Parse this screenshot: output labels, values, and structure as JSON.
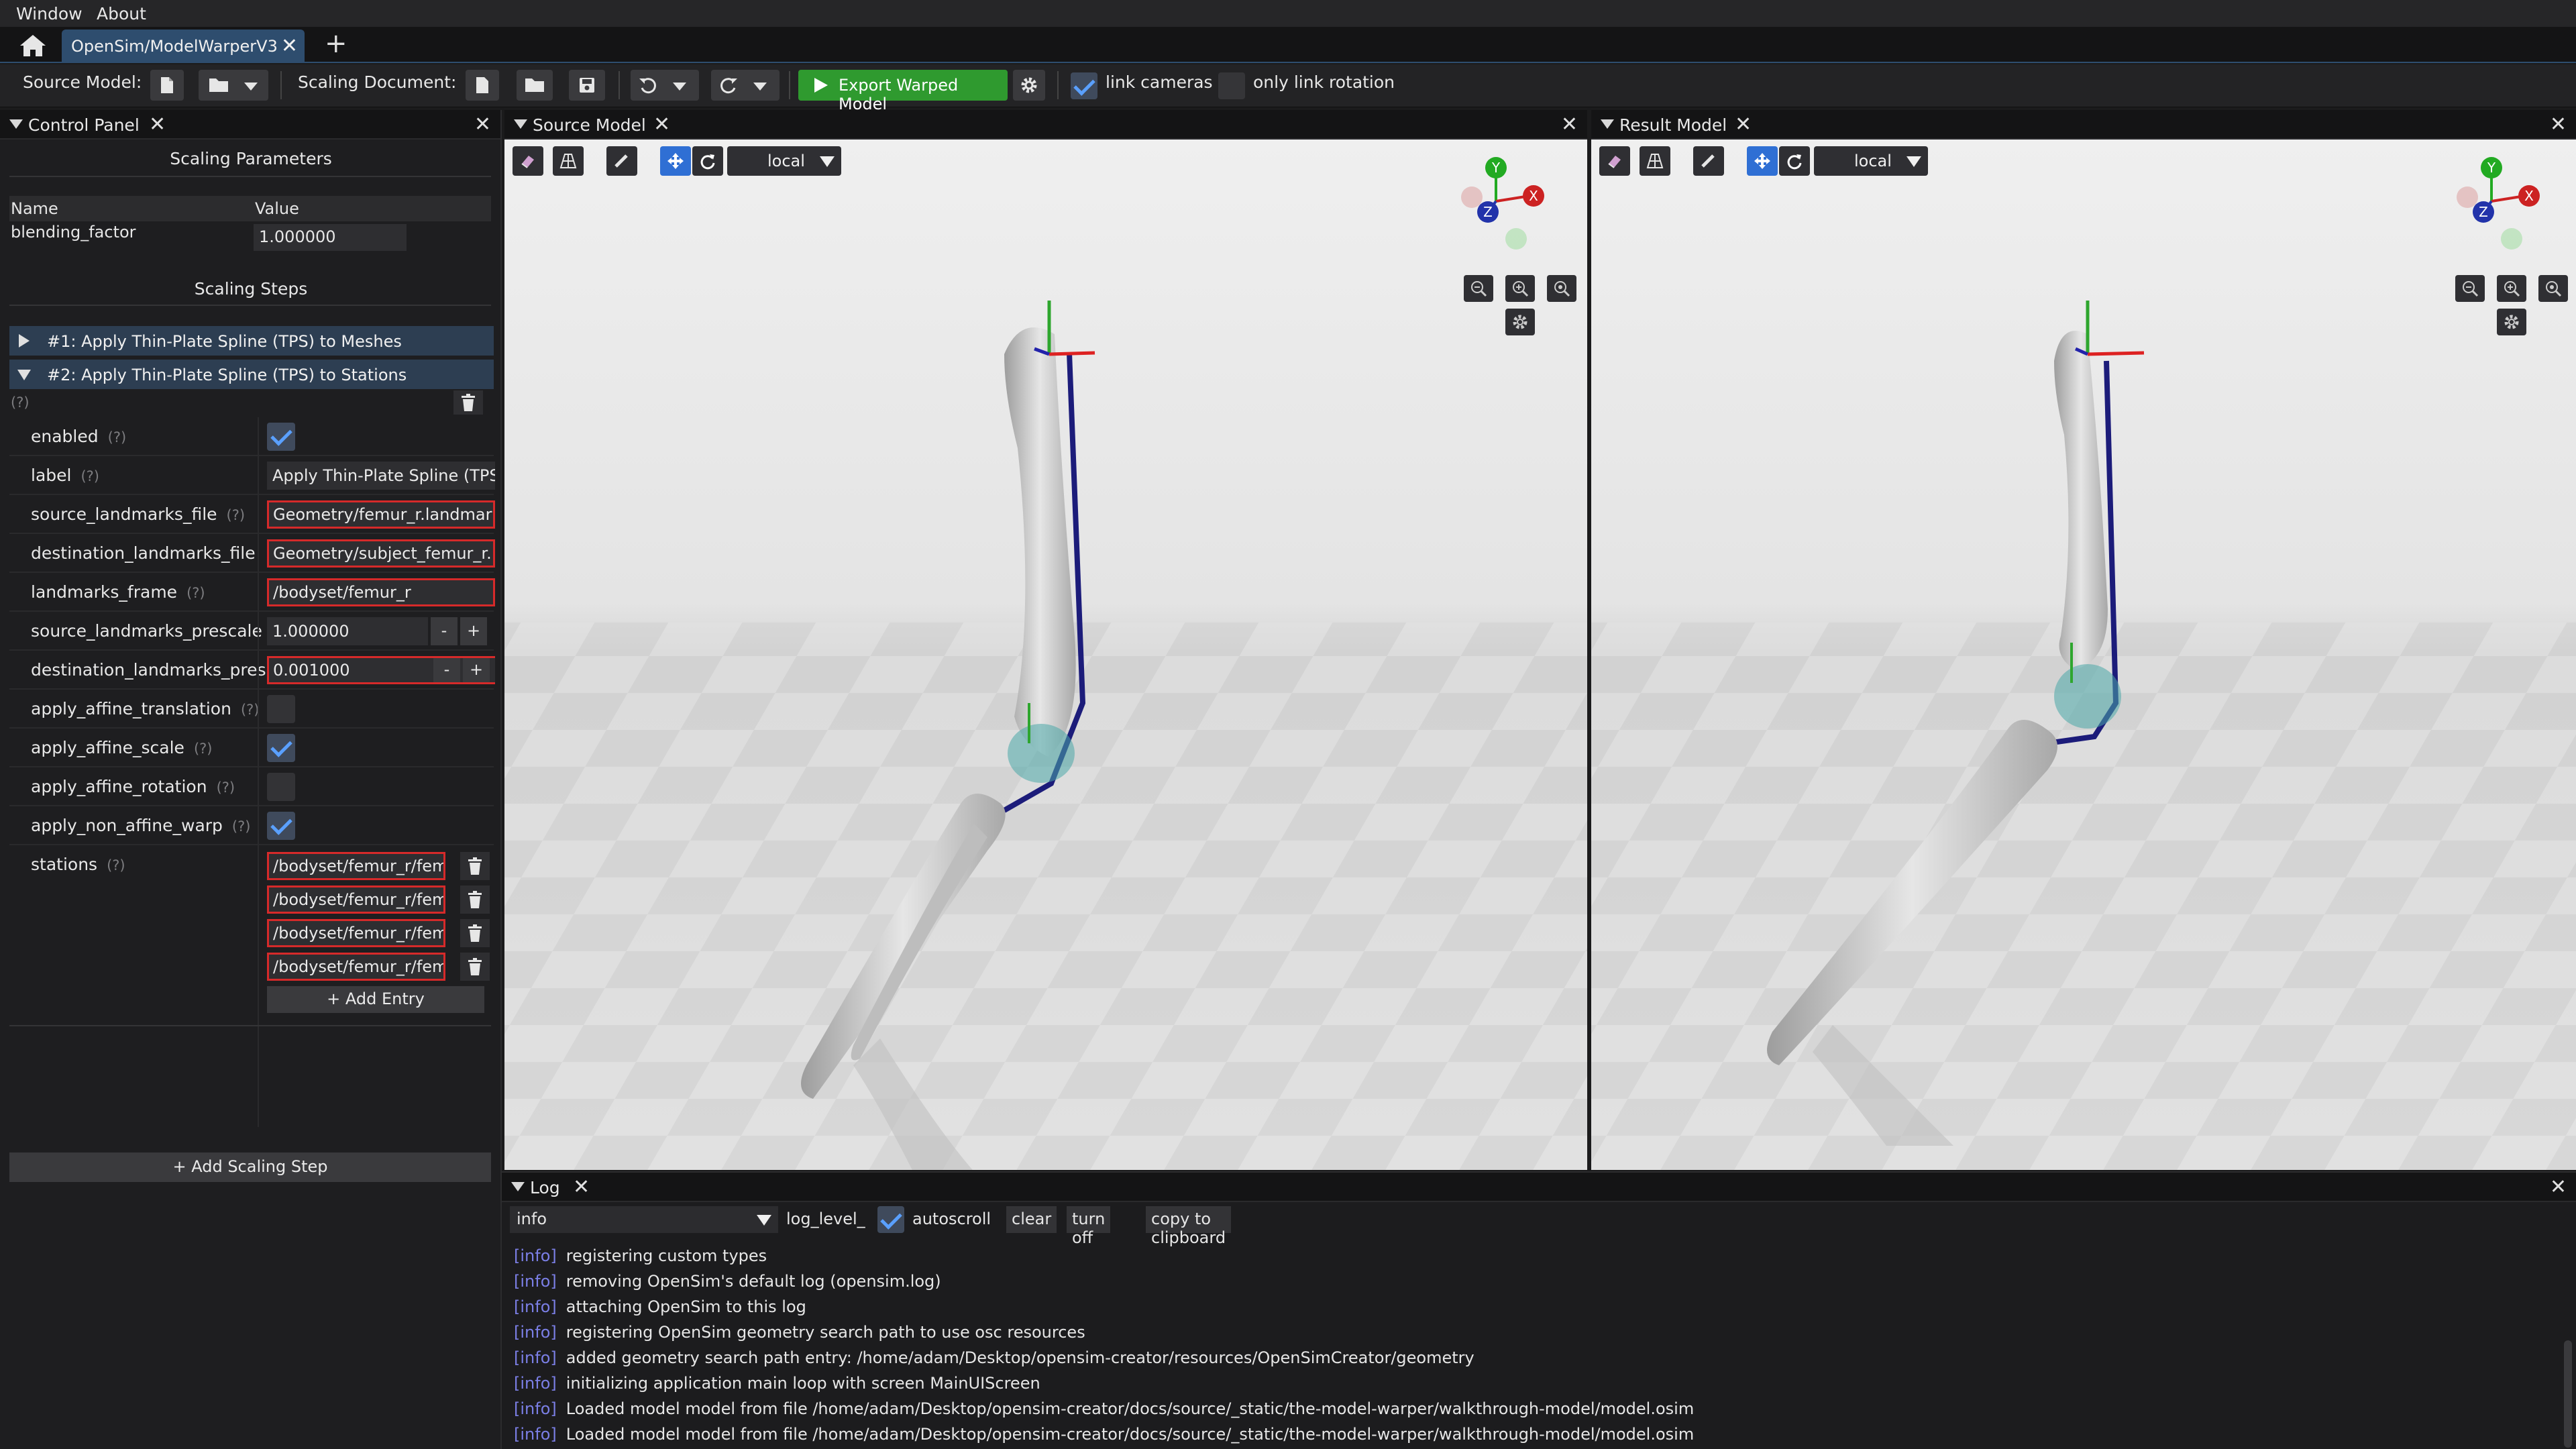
{
  "menu": {
    "window": "Window",
    "about": "About"
  },
  "tabs": {
    "active_tab": "OpenSim/ModelWarperV3",
    "close": "✕",
    "add": "+"
  },
  "toolbar": {
    "source_model_label": "Source Model:",
    "scaling_document_label": "Scaling Document:",
    "export_label": "Export Warped Model",
    "link_cameras_label": "link cameras",
    "link_cameras_checked": true,
    "only_link_rotation_label": "only link rotation",
    "only_link_rotation_checked": false
  },
  "control_panel": {
    "title": "Control Panel",
    "scaling_parameters_title": "Scaling Parameters",
    "param_table": {
      "col_name": "Name",
      "col_value": "Value",
      "rows": [
        {
          "name": "blending_factor",
          "value": "1.000000"
        }
      ]
    },
    "scaling_steps_title": "Scaling Steps",
    "steps": [
      {
        "label": "#1: Apply Thin-Plate Spline (TPS) to Meshes",
        "expanded": false
      },
      {
        "label": "#2: Apply Thin-Plate Spline (TPS) to Stations",
        "expanded": true
      }
    ],
    "help_marker": "(?)",
    "properties": [
      {
        "name": "enabled",
        "help": "(?)",
        "type": "checkbox",
        "checked": true
      },
      {
        "name": "label",
        "help": "(?)",
        "type": "text",
        "value": "Apply Thin-Plate Spline (TPS) to Stations",
        "error": false
      },
      {
        "name": "source_landmarks_file",
        "help": "(?)",
        "type": "text",
        "value": "Geometry/femur_r.landmarks",
        "error": true
      },
      {
        "name": "destination_landmarks_file",
        "help": "",
        "type": "text",
        "value": "Geometry/subject_femur_r.landmarks",
        "error": true
      },
      {
        "name": "landmarks_frame",
        "help": "(?)",
        "type": "text",
        "value": "/bodyset/femur_r",
        "error": true
      },
      {
        "name": "source_landmarks_prescale",
        "help": "",
        "type": "number",
        "value": "1.000000",
        "error": false
      },
      {
        "name": "destination_landmarks_pres",
        "help": "",
        "type": "number",
        "value": "0.001000",
        "error": true
      },
      {
        "name": "apply_affine_translation",
        "help": "(?)",
        "type": "checkbox",
        "checked": false
      },
      {
        "name": "apply_affine_scale",
        "help": "(?)",
        "type": "checkbox",
        "checked": true
      },
      {
        "name": "apply_affine_rotation",
        "help": "(?)",
        "type": "checkbox",
        "checked": false
      },
      {
        "name": "apply_non_affine_warp",
        "help": "(?)",
        "type": "checkbox",
        "checked": true
      }
    ],
    "stations": {
      "name": "stations",
      "help": "(?)",
      "entries": [
        "/bodyset/femur_r/femur_r_station",
        "/bodyset/femur_r/femur_r_station",
        "/bodyset/femur_r/femur_r_station",
        "/bodyset/femur_r/femur_r_station"
      ],
      "add_entry_label": "Add Entry"
    },
    "add_step_label": "Add Scaling Step"
  },
  "source_panel": {
    "title": "Source Model",
    "frame_option": "local",
    "gizmo": {
      "x": "X",
      "y": "Y",
      "z": "Z"
    }
  },
  "result_panel": {
    "title": "Result Model",
    "frame_option": "local",
    "gizmo": {
      "x": "X",
      "y": "Y",
      "z": "Z"
    }
  },
  "log": {
    "title": "Log",
    "level_select": "info",
    "level_label": "log_level_",
    "autoscroll_label": "autoscroll",
    "autoscroll_checked": true,
    "clear_label": "clear",
    "turn_off_label": "turn off",
    "copy_label": "copy to clipboard",
    "lines": [
      {
        "level": "[info]",
        "text": "registering custom types"
      },
      {
        "level": "[info]",
        "text": "removing OpenSim's default log (opensim.log)"
      },
      {
        "level": "[info]",
        "text": "attaching OpenSim to this log"
      },
      {
        "level": "[info]",
        "text": "registering OpenSim geometry search path to use osc resources"
      },
      {
        "level": "[info]",
        "text": "added geometry search path entry: /home/adam/Desktop/opensim-creator/resources/OpenSimCreator/geometry"
      },
      {
        "level": "[info]",
        "text": "initializing application main loop with screen MainUIScreen"
      },
      {
        "level": "[info]",
        "text": "Loaded model model from file /home/adam/Desktop/opensim-creator/docs/source/_static/the-model-warper/walkthrough-model/model.osim"
      },
      {
        "level": "[info]",
        "text": "Loaded model model from file /home/adam/Desktop/opensim-creator/docs/source/_static/the-model-warper/walkthrough-model/model.osim"
      }
    ]
  },
  "colors": {
    "accent": "#2e4d6e",
    "export_green": "#2f9a2f",
    "error_red": "#d62a2a",
    "check_blue": "#5aa0ff",
    "log_level": "#7b7fe6"
  }
}
